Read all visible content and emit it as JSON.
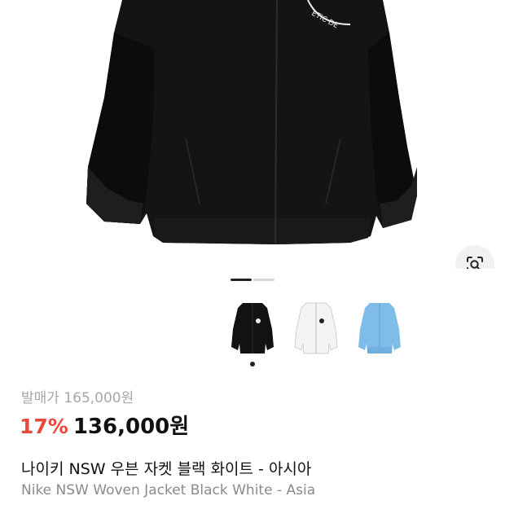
{
  "hero": {
    "image_name": "black-jacket-photo",
    "chest_logo_text": "ETIC DE",
    "lens_icon": "visual-search-icon"
  },
  "carousel": {
    "current": 1,
    "total": 2
  },
  "thumbnails": [
    {
      "name": "black",
      "color": "#111111"
    },
    {
      "name": "white",
      "color": "#f4f4f4"
    },
    {
      "name": "sky-blue",
      "color": "#7fbde8"
    }
  ],
  "selected_thumbnail": 0,
  "product": {
    "original_price": "발매가 165,000원",
    "discount": "17%",
    "price": "136,000원",
    "title_ko": "나이키 NSW 우븐 자켓 블랙 화이트 - 아시아",
    "title_en": "Nike NSW Woven Jacket Black White - Asia"
  },
  "colors": {
    "discount": "#e8483c",
    "muted_text": "#a6a6a6"
  }
}
